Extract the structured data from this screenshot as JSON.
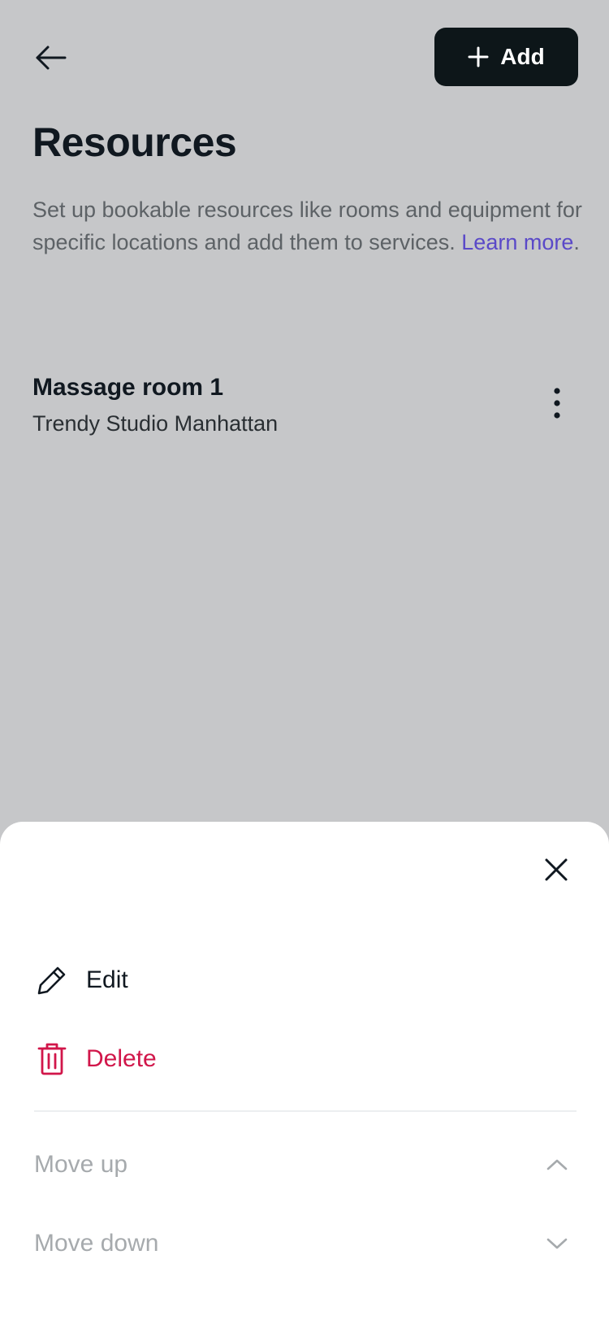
{
  "header": {
    "back_icon": "arrow-left-icon",
    "add_button": {
      "icon": "plus-icon",
      "label": "Add",
      "background": "#0d1619"
    }
  },
  "page": {
    "title": "Resources",
    "description": "Set up bookable resources like rooms and equipment for specific locations and add them to services.",
    "learn_more": "Learn more",
    "link_color": "#5a49c8"
  },
  "resources": [
    {
      "name": "Massage room 1",
      "location": "Trendy Studio Manhattan",
      "menu_icon": "more-vertical-icon"
    }
  ],
  "action_sheet": {
    "close_icon": "close-icon",
    "items": [
      {
        "label": "Edit",
        "icon": "pencil-icon"
      },
      {
        "label": "Delete",
        "icon": "trash-icon",
        "color": "#d1164a"
      }
    ],
    "reorder": [
      {
        "label": "Move up",
        "icon": "chevron-up-icon"
      },
      {
        "label": "Move down",
        "icon": "chevron-down-icon"
      }
    ]
  },
  "colors": {
    "overlay_background": "#c6c7c9",
    "sheet_background": "#ffffff",
    "disabled_text": "#a6aaad"
  }
}
